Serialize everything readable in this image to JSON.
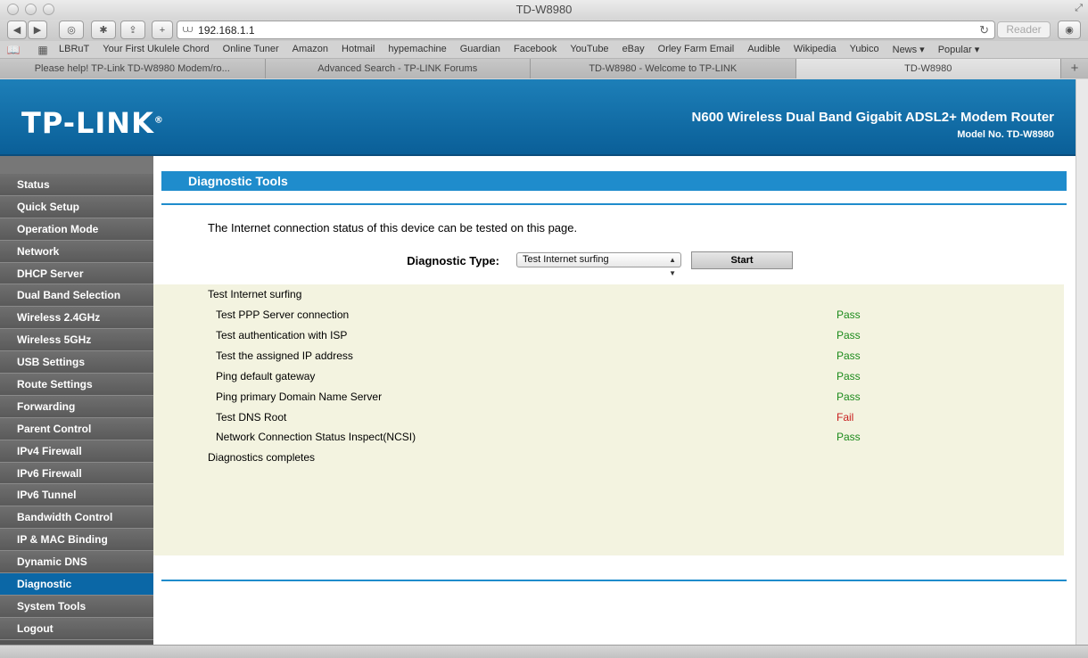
{
  "window": {
    "title": "TD-W8980"
  },
  "toolbar": {
    "address": "192.168.1.1",
    "reader_label": "Reader"
  },
  "bookmarks": [
    "LBRuT",
    "Your First Ukulele Chord",
    "Online Tuner",
    "Amazon",
    "Hotmail",
    "hypemachine",
    "Guardian",
    "Facebook",
    "YouTube",
    "eBay",
    "Orley Farm Email",
    "Audible",
    "Wikipedia",
    "Yubico",
    "News ▾",
    "Popular ▾"
  ],
  "tabs": [
    {
      "label": "Please help! TP-Link TD-W8980 Modem/ro...",
      "active": false
    },
    {
      "label": "Advanced Search - TP-LINK Forums",
      "active": false
    },
    {
      "label": "TD-W8980 - Welcome to TP-LINK",
      "active": false
    },
    {
      "label": "TD-W8980",
      "active": true
    }
  ],
  "banner": {
    "logo": "TP-LINK",
    "product": "N600 Wireless Dual Band Gigabit ADSL2+ Modem Router",
    "model": "Model No. TD-W8980"
  },
  "menu": [
    "Status",
    "Quick Setup",
    "Operation Mode",
    "Network",
    "DHCP Server",
    "Dual Band Selection",
    "Wireless 2.4GHz",
    "Wireless 5GHz",
    "USB Settings",
    "Route Settings",
    "Forwarding",
    "Parent Control",
    "IPv4 Firewall",
    "IPv6 Firewall",
    "IPv6 Tunnel",
    "Bandwidth Control",
    "IP & MAC Binding",
    "Dynamic DNS",
    "Diagnostic",
    "System Tools",
    "Logout"
  ],
  "menu_active": "Diagnostic",
  "main": {
    "section_title": "Diagnostic Tools",
    "intro": "The Internet connection status of this device can be tested on this page.",
    "diag_label": "Diagnostic Type:",
    "diag_selected": "Test Internet surfing",
    "start_label": "Start",
    "results_heading": "Test Internet surfing",
    "results": [
      {
        "name": "Test PPP Server connection",
        "status": "Pass"
      },
      {
        "name": "Test authentication with ISP",
        "status": "Pass"
      },
      {
        "name": "Test the assigned IP address",
        "status": "Pass"
      },
      {
        "name": "Ping default gateway",
        "status": "Pass"
      },
      {
        "name": "Ping primary Domain Name Server",
        "status": "Pass"
      },
      {
        "name": "Test DNS Root",
        "status": "Fail"
      },
      {
        "name": "Network Connection Status Inspect(NCSI)",
        "status": "Pass"
      }
    ],
    "results_footer": "Diagnostics completes"
  },
  "colors": {
    "brand_blue": "#1f8ccc",
    "pass": "#1b8a1b",
    "fail": "#c81e1e"
  }
}
